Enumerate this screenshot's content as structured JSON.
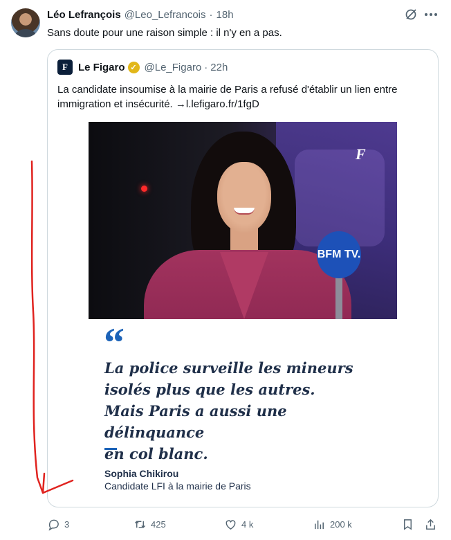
{
  "tweet": {
    "author_name": "Léo Lefrançois",
    "author_handle": "@Leo_Lefrancois",
    "separator": "·",
    "time": "18h",
    "text": "Sans doute pour une raison simple : il n'y en a pas."
  },
  "quoted": {
    "logo_text": "F",
    "author_name": "Le Figaro",
    "author_handle": "@Le_Figaro",
    "separator": "·",
    "time": "22h",
    "text": "La candidate insoumise à la mairie de Paris a refusé d'établir un lien entre immigration et insécurité. →l.lefigaro.fr/1fgD",
    "image": {
      "mic_label": "BFM TV.",
      "watermark": "F",
      "quote_mark": "“",
      "quote_lines": [
        "La police surveille les mineurs",
        "isolés plus que les autres.",
        "Mais Paris a aussi une délinquance",
        "en col blanc."
      ],
      "speaker": "Sophia Chikirou",
      "speaker_role": "Candidate LFI à la mairie de Paris"
    }
  },
  "actions": {
    "replies": "3",
    "retweets": "425",
    "likes": "4 k",
    "views": "200 k"
  },
  "colors": {
    "annotation_arrow": "#e0231f",
    "verified_badge": "#e2b719",
    "quote_accent": "#1c63b8"
  }
}
